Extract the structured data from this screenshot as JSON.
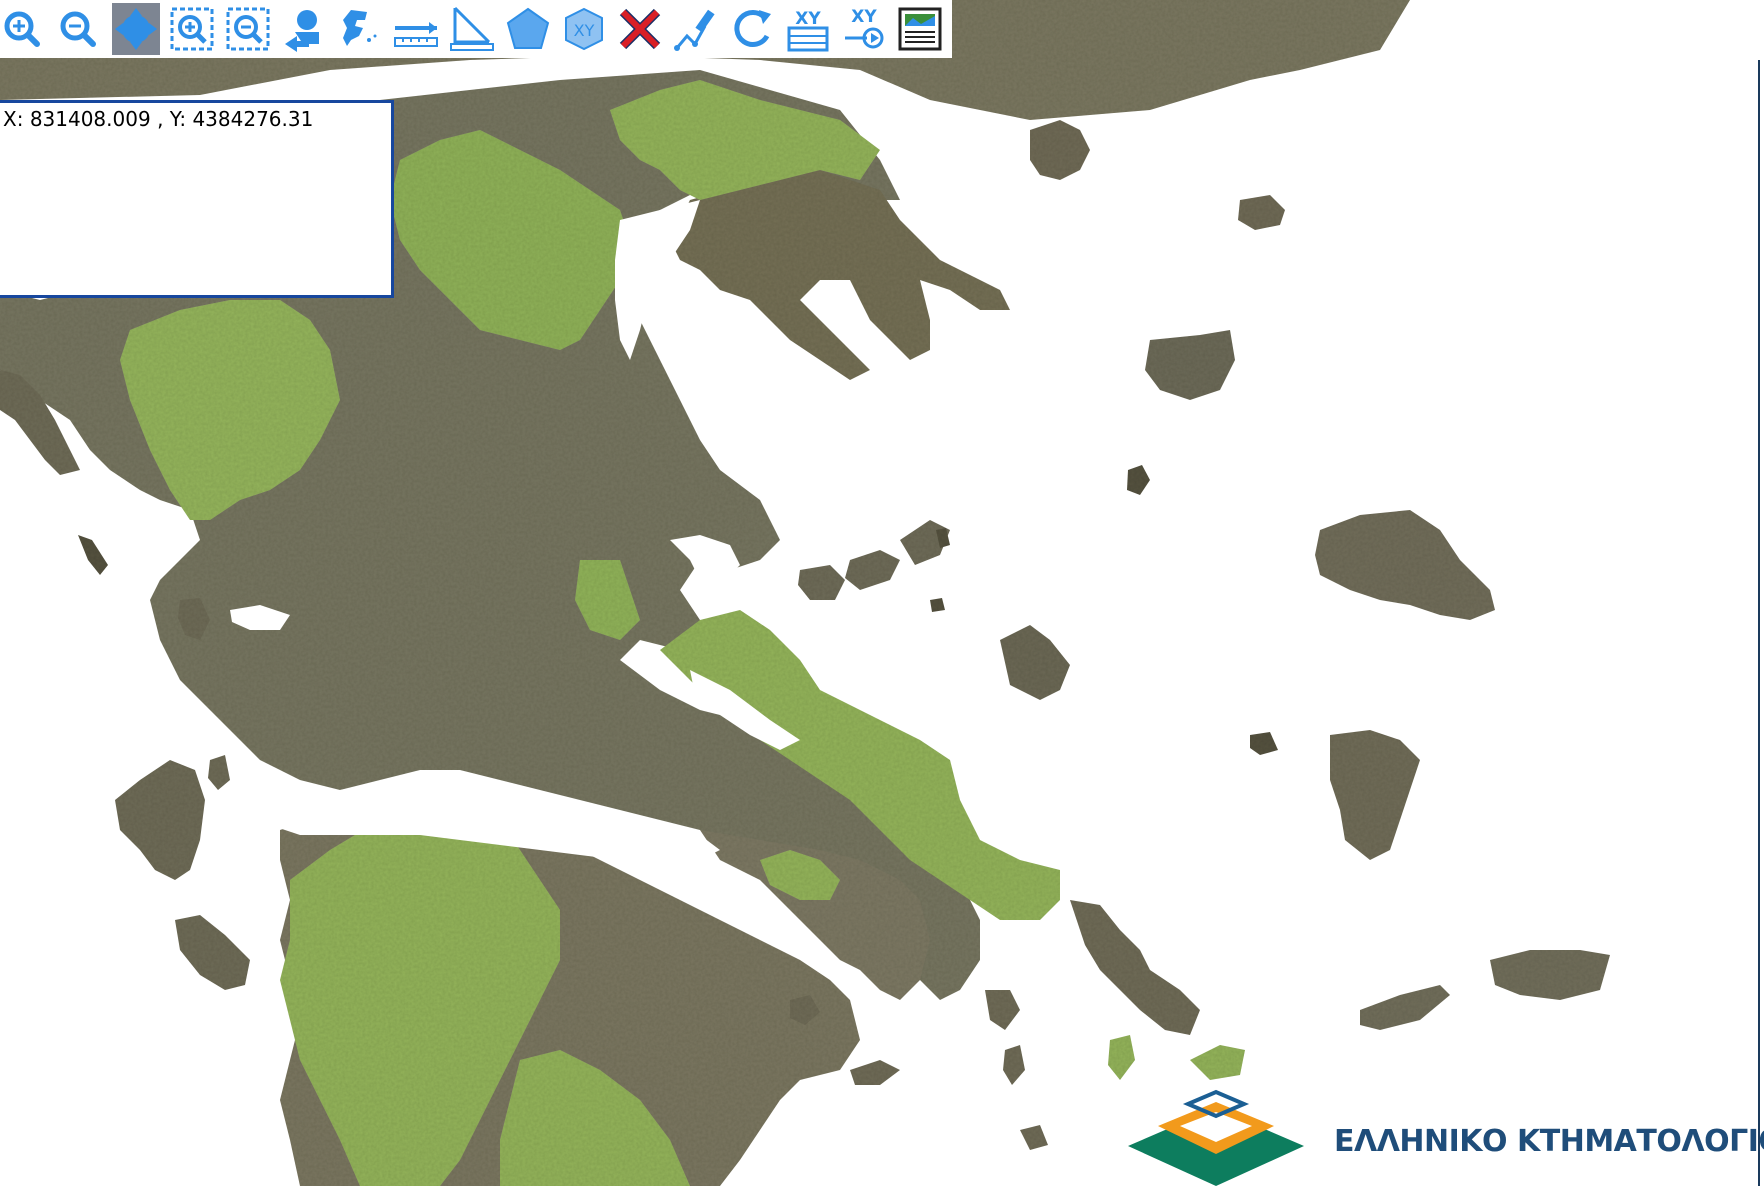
{
  "toolbar": {
    "tools": [
      {
        "name": "zoom-in-icon",
        "active": false
      },
      {
        "name": "zoom-out-icon",
        "active": false
      },
      {
        "name": "pan-icon",
        "active": true
      },
      {
        "name": "zoom-box-in-icon",
        "active": false
      },
      {
        "name": "zoom-box-out-icon",
        "active": false
      },
      {
        "name": "previous-extent-icon",
        "active": false
      },
      {
        "name": "full-extent-greece-icon",
        "active": false
      },
      {
        "name": "measure-distance-icon",
        "active": false
      },
      {
        "name": "measure-angle-icon",
        "active": false
      },
      {
        "name": "polygon-icon",
        "active": false
      },
      {
        "name": "xy-polygon-icon",
        "active": false
      },
      {
        "name": "clear-icon",
        "active": false
      },
      {
        "name": "draw-icon",
        "active": false
      },
      {
        "name": "refresh-icon",
        "active": false
      },
      {
        "name": "xy-table-icon",
        "active": false
      },
      {
        "name": "xy-goto-icon",
        "active": false
      },
      {
        "name": "print-map-icon",
        "active": false
      }
    ],
    "icon_color": "#2f8fe6",
    "active_background": "#7d8592"
  },
  "coords_panel": {
    "x_label": "X:",
    "x_value": "831408.009",
    "separator": ",",
    "y_label": "Y:",
    "y_value": "4384276.31",
    "border_color": "#17479e"
  },
  "logo": {
    "text": "ΕΛΛΗΝΙΚΟ ΚΤΗΜΑΤΟΛΟΓΙΟ",
    "text_color": "#1f4d7a",
    "colors": [
      "#0d7d5e",
      "#f29a1c",
      "#1b5f94"
    ]
  },
  "map": {
    "sea_color": "#ffffff",
    "land_color": "#7d7a62",
    "highlight_color": "#93b35a"
  }
}
